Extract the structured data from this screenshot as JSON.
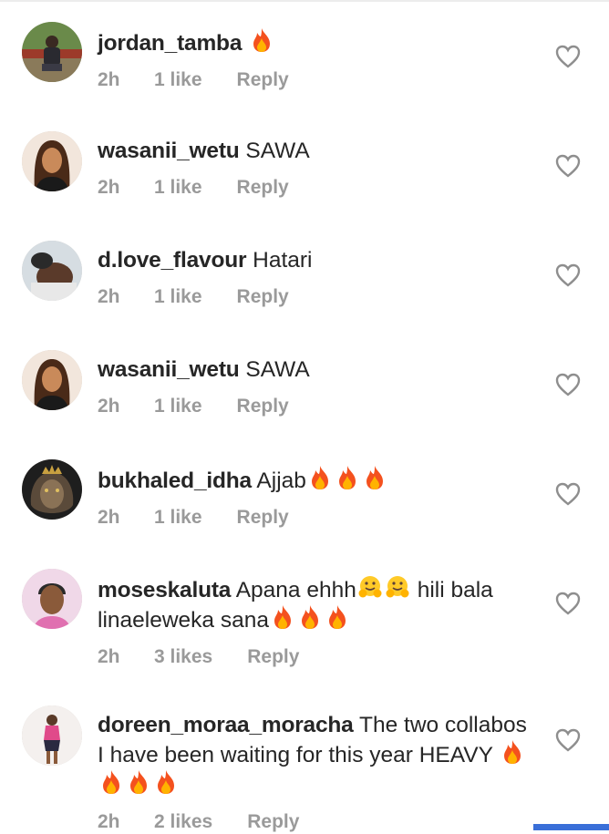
{
  "comments": [
    {
      "user": "jordan_tamba",
      "text": "",
      "emoji": [
        "fire"
      ],
      "time": "2h",
      "likes": "1 like",
      "reply": "Reply",
      "avatar_icon": "avatar-man-sitting-icon"
    },
    {
      "user": "wasanii_wetu",
      "text": "SAWA",
      "emoji": [],
      "time": "2h",
      "likes": "1 like",
      "reply": "Reply",
      "avatar_icon": "avatar-woman-icon"
    },
    {
      "user": "d.love_flavour",
      "text": "Hatari",
      "emoji": [],
      "time": "2h",
      "likes": "1 like",
      "reply": "Reply",
      "avatar_icon": "avatar-man-closeup-icon"
    },
    {
      "user": "wasanii_wetu",
      "text": "SAWA",
      "emoji": [],
      "time": "2h",
      "likes": "1 like",
      "reply": "Reply",
      "avatar_icon": "avatar-woman-icon"
    },
    {
      "user": "bukhaled_idha",
      "text": "Ajjab",
      "emoji": [
        "fire",
        "fire",
        "fire"
      ],
      "time": "2h",
      "likes": "1 like",
      "reply": "Reply",
      "avatar_icon": "avatar-lion-icon"
    },
    {
      "user": "moseskaluta",
      "text": "Apana ehhh",
      "emoji_mid": [
        "hug",
        "hug"
      ],
      "text2": "hili bala linaeleweka sana",
      "emoji": [
        "fire",
        "fire",
        "fire"
      ],
      "time": "2h",
      "likes": "3 likes",
      "reply": "Reply",
      "avatar_icon": "avatar-young-man-icon"
    },
    {
      "user": "doreen_moraa_moracha",
      "text": "The two collabos I have been waiting for this year HEAVY",
      "emoji": [
        "fire",
        "fire",
        "fire",
        "fire"
      ],
      "time": "2h",
      "likes": "2 likes",
      "reply": "Reply",
      "avatar_icon": "avatar-woman-standing-icon"
    }
  ],
  "icons": {
    "like": "heart-outline-icon",
    "fire": "fire-emoji-icon",
    "hug": "hugging-face-emoji-icon"
  },
  "colors": {
    "username": "#262626",
    "meta": "#9a9a9a",
    "heart": "#8e8e8e"
  }
}
